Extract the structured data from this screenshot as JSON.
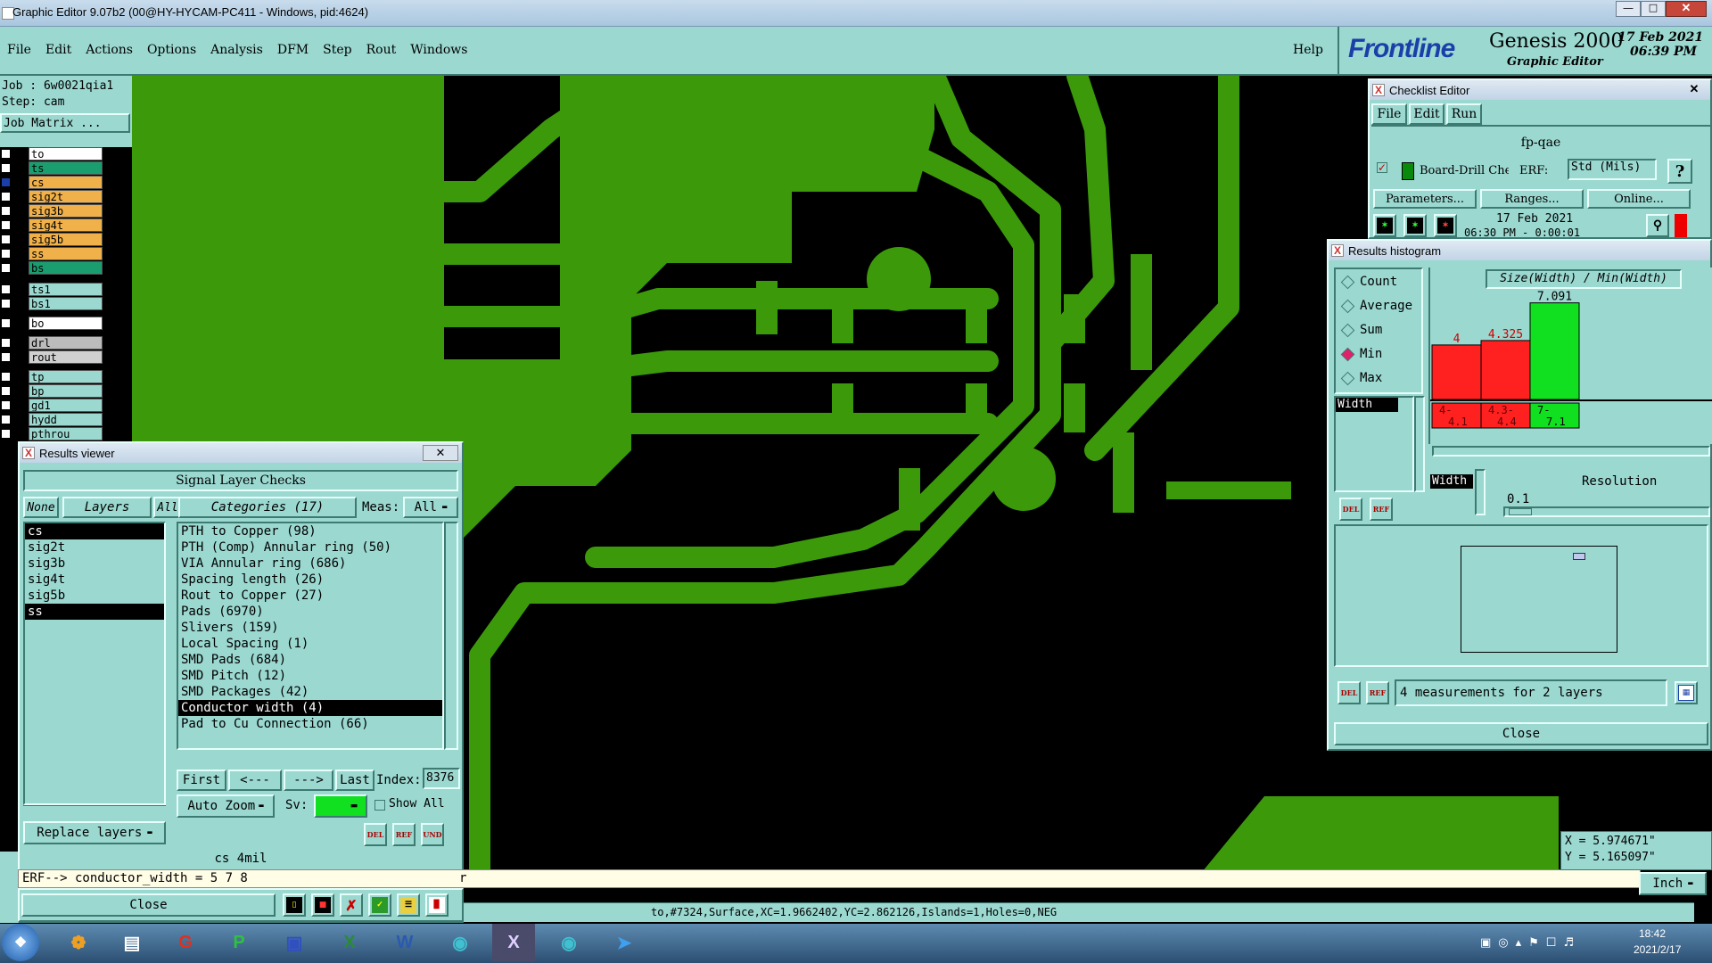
{
  "window": {
    "title": "Graphic Editor 9.07b2 (00@HY-HYCAM-PC411 - Windows, pid:4624)"
  },
  "menu": {
    "items": [
      "File",
      "Edit",
      "Actions",
      "Options",
      "Analysis",
      "DFM",
      "Step",
      "Rout",
      "Windows"
    ],
    "help": "Help"
  },
  "brand": {
    "logo": "Frontline",
    "product": "Genesis 2000",
    "subtitle": "Graphic Editor",
    "date": "17 Feb 2021",
    "time": "06:39 PM"
  },
  "job": {
    "job_label": "Job : 6w0021qia1",
    "step_label": "Step: cam",
    "matrix_button": "Job Matrix ..."
  },
  "layers": [
    {
      "name": "to",
      "color": "#ffffff",
      "checked": false
    },
    {
      "name": "ts",
      "color": "#1a9e70",
      "checked": false
    },
    {
      "name": "cs",
      "color": "#f0b04a",
      "checked": true
    },
    {
      "name": "sig2t",
      "color": "#f0b04a",
      "checked": false
    },
    {
      "name": "sig3b",
      "color": "#f0b04a",
      "checked": false
    },
    {
      "name": "sig4t",
      "color": "#f0b04a",
      "checked": false
    },
    {
      "name": "sig5b",
      "color": "#f0b04a",
      "checked": false
    },
    {
      "name": "ss",
      "color": "#f0b04a",
      "checked": false
    },
    {
      "name": "bs",
      "color": "#1a9e70",
      "checked": false
    },
    {
      "name": "ts1",
      "color": "#9ad8d0",
      "checked": false
    },
    {
      "name": "bs1",
      "color": "#9ad8d0",
      "checked": false
    },
    {
      "name": "bo",
      "color": "#ffffff",
      "checked": false
    },
    {
      "name": "drl",
      "color": "#bcbcbc",
      "checked": false
    },
    {
      "name": "rout",
      "color": "#d0d0d0",
      "checked": false
    },
    {
      "name": "tp",
      "color": "#9ad8d0",
      "checked": false
    },
    {
      "name": "bp",
      "color": "#9ad8d0",
      "checked": false
    },
    {
      "name": "gd1",
      "color": "#9ad8d0",
      "checked": false
    },
    {
      "name": "hydd",
      "color": "#9ad8d0",
      "checked": false
    },
    {
      "name": "pthrou",
      "color": "#9ad8d0",
      "checked": false
    }
  ],
  "results_viewer": {
    "title": "Results viewer",
    "header": "Signal Layer Checks",
    "none_btn": "None",
    "layers_btn": "Layers",
    "all_btn": "All",
    "categories_btn": "Categories (17)",
    "meas_label": "Meas:",
    "meas_value": "All",
    "layer_list": [
      "cs",
      "sig2t",
      "sig3b",
      "sig4t",
      "sig5b",
      "ss"
    ],
    "selected_layers": [
      "cs",
      "ss"
    ],
    "categories": [
      "PTH to Copper (98)",
      "PTH (Comp) Annular ring (50)",
      "VIA Annular ring (686)",
      "Spacing length (26)",
      "Rout to Copper (27)",
      "Pads (6970)",
      "Slivers (159)",
      "Local Spacing (1)",
      "SMD Pads (684)",
      "SMD Pitch (12)",
      "SMD Packages (42)",
      "Conductor width (4)",
      "Pad to Cu Connection (66)"
    ],
    "selected_category": "Conductor width (4)",
    "first": "First",
    "prev": "<---",
    "next": "--->",
    "last": "Last",
    "index_label": "Index:",
    "index_value": "8376",
    "auto_zoom": "Auto Zoom",
    "sv_label": "Sv:",
    "show_all": "Show All",
    "replace_layers": "Replace layers",
    "del": "DEL",
    "ref": "REF",
    "und": "UND",
    "status": "cs 4mil",
    "erf_line": "ERF--> conductor_width = 5 7 8",
    "close": "Close"
  },
  "checklist_editor": {
    "title": "Checklist Editor",
    "menu": [
      "File",
      "Edit",
      "Run"
    ],
    "name": "fp-qae",
    "action": "Board-Drill Che",
    "erf_label": "ERF:",
    "erf_value": "Std (Mils)",
    "help_btn": "?",
    "parameters": "Parameters...",
    "ranges": "Ranges...",
    "online": "Online...",
    "run_date": "17 Feb 2021",
    "run_time": "06:30 PM - 0:00:01"
  },
  "histogram": {
    "title": "Results histogram",
    "modes": [
      "Count",
      "Average",
      "Sum",
      "Min",
      "Max"
    ],
    "active_mode": "Min",
    "measure": "Width",
    "chart_title": "Size(Width) / Min(Width)",
    "resolution_label": "Resolution",
    "resolution_value": "0.1",
    "footer": "4 measurements for 2 layers",
    "del": "DEL",
    "ref": "REF",
    "close": "Close"
  },
  "chart_data": {
    "type": "bar",
    "title": "Size(Width) / Min(Width)",
    "categories": [
      "4-\n4.1",
      "4.3-\n4.4",
      "7-\n7.1"
    ],
    "values": [
      4,
      4.325,
      7.091
    ],
    "labels": [
      "4",
      "4.325",
      "7.091"
    ],
    "colors": [
      "#ff2020",
      "#ff2020",
      "#10e020"
    ],
    "ylim": [
      0,
      7.2
    ]
  },
  "coords": {
    "x": "X = 5.974671\"",
    "y": "Y = 5.165097\""
  },
  "units": "Inch",
  "status_line": "to,#7324,Surface,XC=1.9662402,YC=2.862126,Islands=1,Holes=0,NEG",
  "command_echo": "r",
  "taskbar": {
    "time": "18:42",
    "date": "2021/2/17"
  }
}
